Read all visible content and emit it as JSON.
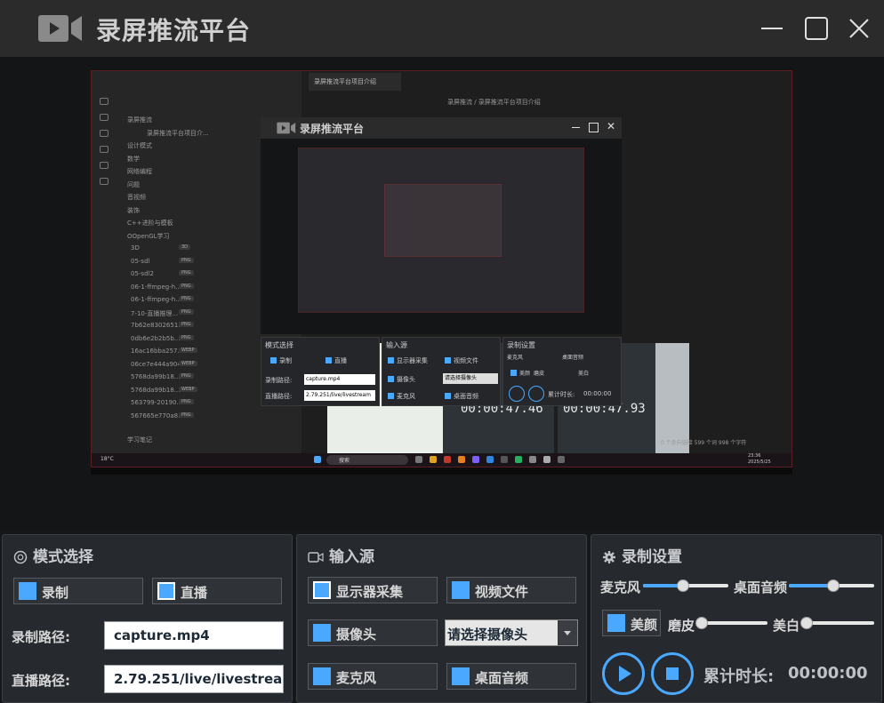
{
  "window": {
    "title": "录屏推流平台",
    "icons": {
      "app": "video-camera-icon",
      "minimize": "minimize-icon",
      "maximize": "maximize-icon",
      "close": "close-icon"
    }
  },
  "preview": {
    "tab_title": "录屏推流平台项目介绍",
    "breadcrumb": "录屏推流 / 录屏推流平台项目介绍",
    "nested_title": "录屏推流平台",
    "sidebar_items": [
      "录屏推流",
      "录屏推流平台项目介...",
      "设计模式",
      "数学",
      "网络编程",
      "问题",
      "音视频",
      "装饰",
      "C++进阶与模板",
      "OOpenGL学习",
      "3D",
      "05-sdl",
      "05-sdl2",
      "06-1-ffmpeg-h...",
      "06-1-ffmpeg-h...",
      "7-10-直播推理...",
      "7b62e8302651...",
      "0db6e2b2b5b...",
      "16ac16bba257...",
      "06ce7e444a904...",
      "5768da99b18...",
      "5768da99b18...",
      "563799-20190...",
      "567665e770a8...",
      "学习笔记"
    ],
    "tags": [
      "3D",
      "PNG",
      "PNG",
      "PNG",
      "PNG",
      "PNG",
      "PNG",
      "PNG",
      "WEBP",
      "WEBP",
      "PNG",
      "WEBP",
      "PNG",
      "PNG"
    ],
    "statusbar": "0 个反向链接   599 个词  998 个字符",
    "taskbar_search": "搜索",
    "taskbar_time": "23:36",
    "taskbar_date": "2025/5/25",
    "weather": "18°C",
    "nested_panels": {
      "mode_title": "模式选择",
      "record": "录制",
      "live": "直播",
      "rec_path_label": "录制路径:",
      "rec_path": "capture.mp4",
      "live_path_label": "直播路径:",
      "live_path": "2.79.251/live/livestream",
      "input_title": "输入源",
      "display": "显示器采集",
      "video_file": "视频文件",
      "camera": "摄像头",
      "camera_select": "请选择摄像头",
      "mic": "麦克风",
      "desktop_audio": "桌面音频",
      "settings_title": "录制设置",
      "set_mic": "麦克风",
      "set_desktop": "桌面音频",
      "beauty": "美颜",
      "smooth": "磨皮",
      "whiten": "美白",
      "elapsed_label": "累计时长:",
      "elapsed": "00:00:00"
    },
    "clip_times": [
      "00:00:47.46",
      "00:00:47.93"
    ]
  },
  "mode_panel": {
    "title": "模式选择",
    "icon": "radio-target-icon",
    "record_label": "录制",
    "record_checked": false,
    "live_label": "直播",
    "live_checked": true,
    "record_path_label": "录制路径:",
    "record_path_value": "capture.mp4",
    "live_path_label": "直播路径:",
    "live_path_value": "2.79.251/live/livestream"
  },
  "input_panel": {
    "title": "输入源",
    "icon": "video-camera-icon",
    "display_label": "显示器采集",
    "display_checked": true,
    "video_file_label": "视频文件",
    "camera_label": "摄像头",
    "camera_select_value": "请选择摄像头",
    "mic_label": "麦克风",
    "desktop_audio_label": "桌面音频"
  },
  "record_panel": {
    "title": "录制设置",
    "icon": "gear-icon",
    "mic_label": "麦克风",
    "mic_level": 0.47,
    "desktop_audio_label": "桌面音频",
    "desktop_audio_level": 0.52,
    "beauty_label": "美颜",
    "smooth_label": "磨皮",
    "smooth_level": 0.0,
    "whiten_label": "美白",
    "whiten_level": 0.0,
    "elapsed_label": "累计时长:",
    "elapsed_value": "00:00:00",
    "accent": "#4aa8ff"
  }
}
